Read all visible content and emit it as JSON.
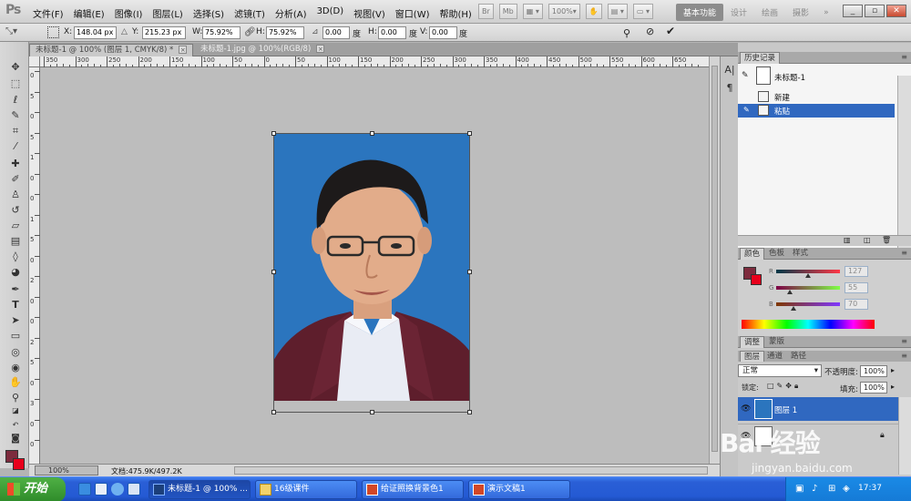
{
  "app": {
    "logo": "Ps"
  },
  "menu": [
    "文件(F)",
    "编辑(E)",
    "图像(I)",
    "图层(L)",
    "选择(S)",
    "滤镜(T)",
    "分析(A)",
    "3D(D)",
    "视图(V)",
    "窗口(W)",
    "帮助(H)"
  ],
  "menu_tools": {
    "br": "Br",
    "mb": "Mb",
    "zoom": "100%"
  },
  "workspaces": [
    "基本功能",
    "设计",
    "绘画",
    "摄影"
  ],
  "workspace_more": "»",
  "window_controls": [
    "_",
    "▫",
    "✕"
  ],
  "options": {
    "x_label": "X:",
    "x_value": "148.04 px",
    "y_label": "Y:",
    "y_value": "215.23 px",
    "w_label": "W:",
    "w_value": "75.92%",
    "h_label": "H:",
    "h_value": "75.92%",
    "angle_value": "0.00",
    "angle_unit": "度",
    "hskew_label": "H:",
    "hskew_value": "0.00",
    "hskew_unit": "度",
    "vskew_label": "V:",
    "vskew_value": "0.00",
    "vskew_unit": "度"
  },
  "doc_tabs": [
    {
      "label": "未标题-1 @ 100% (图层 1, CMYK/8) *",
      "close": "×"
    },
    {
      "label": "未标题-1.jpg @ 100%(RGB/8)",
      "close": "×"
    }
  ],
  "rulers": {
    "h_labels": [
      "350",
      "300",
      "250",
      "200",
      "150",
      "100",
      "50",
      "0",
      "50",
      "100",
      "150",
      "200",
      "250",
      "300",
      "350",
      "400",
      "450",
      "500",
      "550",
      "600",
      "650"
    ],
    "v_labels": [
      "0",
      "5",
      "0",
      "5",
      "1",
      "0",
      "0",
      "1",
      "5",
      "0",
      "2",
      "0",
      "0",
      "2",
      "5",
      "0",
      "3",
      "0",
      "0"
    ]
  },
  "status": {
    "zoom": "100%",
    "doc_size": "文档:475.9K/497.2K"
  },
  "history": {
    "tab": "历史记录",
    "snapshot": "未标题-1",
    "items": [
      "新建",
      "粘贴"
    ],
    "selected_index": 1
  },
  "color_panel": {
    "tabs": [
      "颜色",
      "色板",
      "样式"
    ],
    "r_label": "R",
    "g_label": "G",
    "b_label": "B",
    "r": "127",
    "g": "55",
    "b": "70",
    "r_frac": 0.5,
    "g_frac": 0.22,
    "b_frac": 0.27,
    "foreground": "#7d2b3d",
    "background": "#e8001b"
  },
  "adjust_tabs": [
    "调整",
    "蒙版"
  ],
  "layers_panel": {
    "tabs": [
      "图层",
      "通道",
      "路径"
    ],
    "blend_mode": "正常",
    "opacity_label": "不透明度:",
    "opacity": "100%",
    "lock_label": "锁定:",
    "fill_label": "填充:",
    "fill": "100%",
    "layer_name": "图层 1"
  },
  "taskbar": {
    "start": "开始",
    "tasks": [
      "未标题-1 @ 100% ...",
      "16级课件",
      "给证照换背景色1",
      "演示文稿1"
    ],
    "clock": "17:37"
  },
  "watermark": {
    "main": "Bai 经验",
    "sub": "jingyan.baidu.com"
  }
}
